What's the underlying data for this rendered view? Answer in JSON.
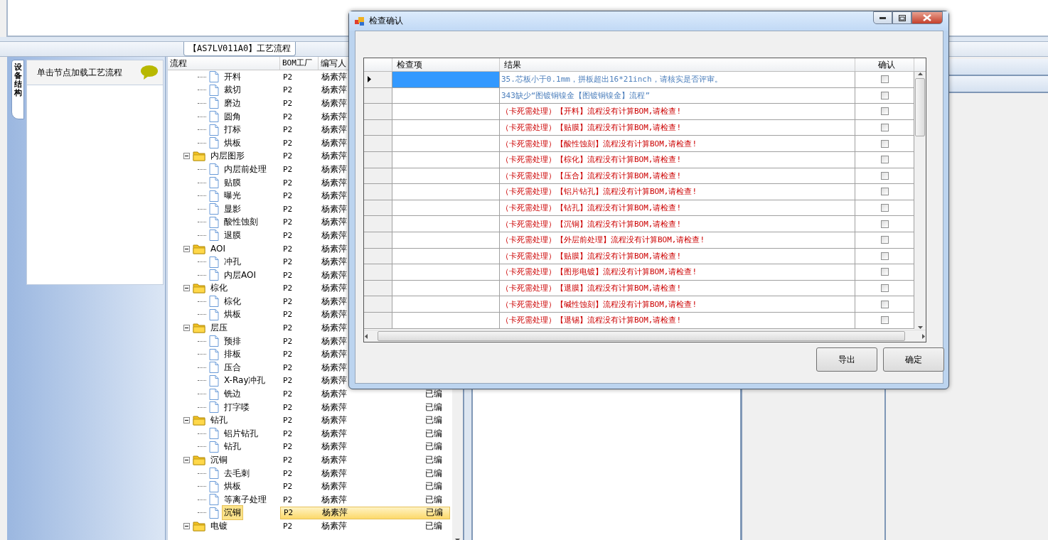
{
  "main_tab": {
    "label": "【AS7LV011A0】工艺流程"
  },
  "side_tab": {
    "label": "设备结构"
  },
  "left_panel": {
    "hint": "单击节点加载工艺流程"
  },
  "tree": {
    "columns": [
      "流程",
      "BOM工厂",
      "编写人"
    ],
    "rows": [
      {
        "kind": "folder",
        "children": [
          {
            "kind": "leaf",
            "label": "开料",
            "factory": "P2",
            "author": "杨素萍",
            "selected": false
          },
          {
            "kind": "leaf",
            "label": "裁切",
            "factory": "P2",
            "author": "杨素萍",
            "selected": false
          },
          {
            "kind": "leaf",
            "label": "磨边",
            "factory": "P2",
            "author": "杨素萍",
            "selected": false
          },
          {
            "kind": "leaf",
            "label": "圆角",
            "factory": "P2",
            "author": "杨素萍",
            "selected": false
          },
          {
            "kind": "leaf",
            "label": "打标",
            "factory": "P2",
            "author": "杨素萍",
            "selected": false
          },
          {
            "kind": "leaf",
            "label": "烘板",
            "factory": "P2",
            "author": "杨素萍",
            "selected": false
          }
        ]
      },
      {
        "kind": "folder",
        "label": "内层图形",
        "factory": "P2",
        "author": "杨素萍",
        "expanded": true,
        "selected": false,
        "children": [
          {
            "kind": "leaf",
            "label": "内层前处理",
            "factory": "P2",
            "author": "杨素萍",
            "selected": false
          },
          {
            "kind": "leaf",
            "label": "贴膜",
            "factory": "P2",
            "author": "杨素萍",
            "selected": false
          },
          {
            "kind": "leaf",
            "label": "曝光",
            "factory": "P2",
            "author": "杨素萍",
            "selected": false
          },
          {
            "kind": "leaf",
            "label": "显影",
            "factory": "P2",
            "author": "杨素萍",
            "selected": false
          },
          {
            "kind": "leaf",
            "label": "酸性蚀刻",
            "factory": "P2",
            "author": "杨素萍",
            "selected": false
          },
          {
            "kind": "leaf",
            "label": "退膜",
            "factory": "P2",
            "author": "杨素萍",
            "selected": false
          }
        ]
      },
      {
        "kind": "folder",
        "label": "AOI",
        "factory": "P2",
        "author": "杨素萍",
        "expanded": true,
        "selected": false,
        "children": [
          {
            "kind": "leaf",
            "label": "冲孔",
            "factory": "P2",
            "author": "杨素萍",
            "selected": false
          },
          {
            "kind": "leaf",
            "label": "内层AOI",
            "factory": "P2",
            "author": "杨素萍",
            "selected": false
          }
        ]
      },
      {
        "kind": "folder",
        "label": "棕化",
        "factory": "P2",
        "author": "杨素萍",
        "expanded": true,
        "selected": false,
        "children": [
          {
            "kind": "leaf",
            "label": "棕化",
            "factory": "P2",
            "author": "杨素萍",
            "selected": false
          },
          {
            "kind": "leaf",
            "label": "烘板",
            "factory": "P2",
            "author": "杨素萍",
            "selected": false
          }
        ]
      },
      {
        "kind": "folder",
        "label": "层压",
        "factory": "P2",
        "author": "杨素萍",
        "expanded": true,
        "selected": false,
        "children": [
          {
            "kind": "leaf",
            "label": "预排",
            "factory": "P2",
            "author": "杨素萍",
            "selected": false
          },
          {
            "kind": "leaf",
            "label": "排板",
            "factory": "P2",
            "author": "杨素萍",
            "selected": false
          },
          {
            "kind": "leaf",
            "label": "压合",
            "factory": "P2",
            "author": "杨素萍",
            "selected": false
          },
          {
            "kind": "leaf",
            "label": "X-Ray冲孔",
            "factory": "P2",
            "author": "杨素萍",
            "selected": false
          },
          {
            "kind": "leaf",
            "label": "铣边",
            "factory": "P2",
            "author": "杨素萍",
            "status": "已编",
            "selected": false
          },
          {
            "kind": "leaf",
            "label": "打字喽",
            "factory": "P2",
            "author": "杨素萍",
            "status": "已编",
            "selected": false
          }
        ]
      },
      {
        "kind": "folder",
        "label": "钻孔",
        "factory": "P2",
        "author": "杨素萍",
        "status": "已编",
        "expanded": true,
        "selected": false,
        "children": [
          {
            "kind": "leaf",
            "label": "铝片钻孔",
            "factory": "P2",
            "author": "杨素萍",
            "status": "已编",
            "selected": false
          },
          {
            "kind": "leaf",
            "label": "钻孔",
            "factory": "P2",
            "author": "杨素萍",
            "status": "已编",
            "selected": false
          }
        ]
      },
      {
        "kind": "folder",
        "label": "沉铜",
        "factory": "P2",
        "author": "杨素萍",
        "status": "已编",
        "expanded": true,
        "selected": false,
        "children": [
          {
            "kind": "leaf",
            "label": "去毛刺",
            "factory": "P2",
            "author": "杨素萍",
            "status": "已编",
            "selected": false
          },
          {
            "kind": "leaf",
            "label": "烘板",
            "factory": "P2",
            "author": "杨素萍",
            "status": "已编",
            "selected": false
          },
          {
            "kind": "leaf",
            "label": "等离子处理",
            "factory": "P2",
            "author": "杨素萍",
            "status": "已编",
            "selected": false
          },
          {
            "kind": "leaf",
            "label": "沉铜",
            "factory": "P2",
            "author": "杨素萍",
            "status": "已编",
            "selected": true
          }
        ]
      },
      {
        "kind": "folder",
        "label": "电镀",
        "factory": "P2",
        "author": "杨素萍",
        "status": "已编",
        "expanded": true,
        "selected": false
      }
    ]
  },
  "dialog": {
    "title": "检查确认",
    "columns": [
      "检查项",
      "结果",
      "确认"
    ],
    "rows": [
      {
        "result": "35.芯板小于0.1mm，拼板超出16*21inch，请核实是否评审。",
        "color": "#4f81bd",
        "checked": false,
        "selected": true
      },
      {
        "result": "343缺少“图镀铜镍金【图镀铜镍金】流程”",
        "color": "#4f81bd",
        "checked": false,
        "selected": false
      },
      {
        "result": "（卡死需处理）【开料】流程没有计算BOM,请检查!",
        "color": "#cc0000",
        "checked": false,
        "selected": false
      },
      {
        "result": "（卡死需处理）【贴膜】流程没有计算BOM,请检查!",
        "color": "#cc0000",
        "checked": false,
        "selected": false
      },
      {
        "result": "（卡死需处理）【酸性蚀刻】流程没有计算BOM,请检查!",
        "color": "#cc0000",
        "checked": false,
        "selected": false
      },
      {
        "result": "（卡死需处理）【棕化】流程没有计算BOM,请检查!",
        "color": "#cc0000",
        "checked": false,
        "selected": false
      },
      {
        "result": "（卡死需处理）【压合】流程没有计算BOM,请检查!",
        "color": "#cc0000",
        "checked": false,
        "selected": false
      },
      {
        "result": "（卡死需处理）【铝片钻孔】流程没有计算BOM,请检查!",
        "color": "#cc0000",
        "checked": false,
        "selected": false
      },
      {
        "result": "（卡死需处理）【钻孔】流程没有计算BOM,请检查!",
        "color": "#cc0000",
        "checked": false,
        "selected": false
      },
      {
        "result": "（卡死需处理）【沉铜】流程没有计算BOM,请检查!",
        "color": "#cc0000",
        "checked": false,
        "selected": false
      },
      {
        "result": "（卡死需处理）【外层前处理】流程没有计算BOM,请检查!",
        "color": "#cc0000",
        "checked": false,
        "selected": false
      },
      {
        "result": "（卡死需处理）【贴膜】流程没有计算BOM,请检查!",
        "color": "#cc0000",
        "checked": false,
        "selected": false
      },
      {
        "result": "（卡死需处理）【图形电镀】流程没有计算BOM,请检查!",
        "color": "#cc0000",
        "checked": false,
        "selected": false
      },
      {
        "result": "（卡死需处理）【退膜】流程没有计算BOM,请检查!",
        "color": "#cc0000",
        "checked": false,
        "selected": false
      },
      {
        "result": "（卡死需处理）【碱性蚀刻】流程没有计算BOM,请检查!",
        "color": "#cc0000",
        "checked": false,
        "selected": false
      },
      {
        "result": "（卡死需处理）【退锡】流程没有计算BOM,请检查!",
        "color": "#cc0000",
        "checked": false,
        "selected": false
      }
    ],
    "buttons": [
      "导出",
      "确定"
    ]
  }
}
